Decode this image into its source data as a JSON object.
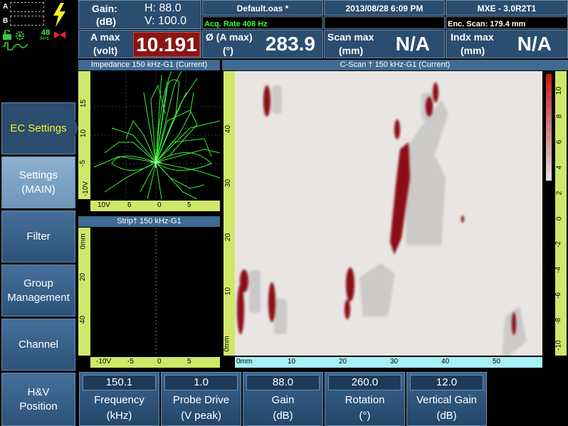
{
  "status": {
    "a": "A",
    "b": "B",
    "rate_badge": "48",
    "rate_unit": "IN+E"
  },
  "header": {
    "gain_label": "Gain:",
    "gain_unit": "(dB)",
    "h_gain": "H: 88.0",
    "v_gain": "V: 100.0",
    "filename": "Default.oas *",
    "acq_rate": "Acq. Rate 408  Hz",
    "datetime": "2013/08/28 6:09 PM",
    "version": "MXE - 3.0R2T1",
    "enc_scan": "Enc. Scan:  179.4 mm",
    "amax_label": "A max",
    "amax_unit": "(volt)",
    "amax_value": "10.191",
    "phase_label": "Ø (A max)",
    "phase_unit": "(°)",
    "phase_value": "283.9",
    "scanmax_label": "Scan max",
    "scanmax_unit": "(mm)",
    "scanmax_value": "N/A",
    "indxmax_label": "Indx max",
    "indxmax_unit": "(mm)",
    "indxmax_value": "N/A"
  },
  "sidebar": {
    "items": [
      {
        "label": "EC Settings"
      },
      {
        "label": "Settings (MAIN)"
      },
      {
        "label": "Filter"
      },
      {
        "label": "Group Management"
      },
      {
        "label": "Channel"
      },
      {
        "label": "H&V Position"
      }
    ]
  },
  "impedance": {
    "title": "Impedance 150 kHz-G1 (Current)",
    "v_ticks": [
      "15",
      "10",
      "-5",
      "-10V"
    ],
    "h_ticks": [
      "10V",
      "6",
      "0",
      "5"
    ]
  },
  "strip": {
    "title": "Strip† 150 kHz-G1",
    "v_ticks": [
      "0mm",
      "20",
      "40"
    ],
    "h_ticks": [
      "-10V",
      "-5",
      "0",
      "5"
    ]
  },
  "cscan": {
    "title": "C-Scan † 150 kHz-G1 (Current)",
    "v_ticks": [
      "40",
      "30",
      "20",
      "10",
      "0mm"
    ],
    "h_ticks": [
      "0mm",
      "10",
      "20",
      "30",
      "40",
      "50"
    ],
    "r_ticks": [
      "10",
      "8",
      "6",
      "4",
      "2",
      "0",
      "-2",
      "-4",
      "-6",
      "-8",
      "-10"
    ]
  },
  "params": [
    {
      "value": "150.1",
      "label": "Frequency",
      "unit": "(kHz)"
    },
    {
      "value": "1.0",
      "label": "Probe Drive",
      "unit": "(V peak)"
    },
    {
      "value": "88.0",
      "label": "Gain",
      "unit": "(dB)"
    },
    {
      "value": "260.0",
      "label": "Rotation",
      "unit": "(°)"
    },
    {
      "value": "12.0",
      "label": "Vertical Gain",
      "unit": "(dB)"
    }
  ],
  "colors": {
    "accent_yellow": "#f7f22a",
    "amax_bg": "#8b1515",
    "trace_green": "#39ff3a",
    "indication_red": "#8c0f12"
  }
}
